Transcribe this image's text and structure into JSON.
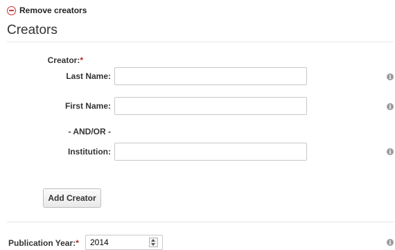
{
  "creators_section": {
    "remove_label": "Remove creators",
    "title": "Creators",
    "creator_label": "Creator:",
    "required_mark": "*",
    "fields": {
      "last_name": {
        "label": "Last Name:",
        "value": ""
      },
      "first_name": {
        "label": "First Name:",
        "value": ""
      },
      "and_or": "- AND/OR -",
      "institution": {
        "label": "Institution:",
        "value": ""
      }
    },
    "info_glyph": "i",
    "add_button_label": "Add Creator"
  },
  "publication_year": {
    "label": "Publication Year:",
    "required_mark": "*",
    "value": "2014"
  },
  "colors": {
    "remove_icon": "#c9302c",
    "required": "#b02a2a",
    "info_icon": "#9a9a9a"
  },
  "icons": [
    "remove-circle-icon",
    "info-icon",
    "spinner-arrows-icon"
  ]
}
